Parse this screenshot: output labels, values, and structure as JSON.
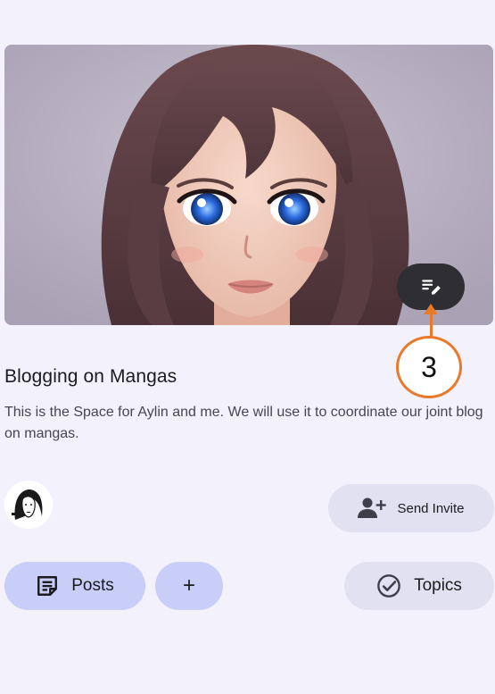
{
  "space": {
    "title": "Blogging on Mangas",
    "description": "This is the Space for Aylin and me. We will use it to coordinate our joint blog on mangas."
  },
  "annotation": {
    "label": "3"
  },
  "actions": {
    "send_invite_label": "Send Invite",
    "posts_label": "Posts",
    "add_label": "+",
    "topics_label": "Topics"
  },
  "icons": {
    "edit": "edit-note-icon",
    "invite": "person-add-icon",
    "posts": "sticky-note-icon",
    "topics": "check-circle-icon"
  },
  "colors": {
    "background": "#f3f1fb",
    "primary_container": "#c9cef8",
    "secondary_container": "#e2e1f1",
    "fab": "#2f2f33",
    "annotation": "#e87a2c"
  }
}
